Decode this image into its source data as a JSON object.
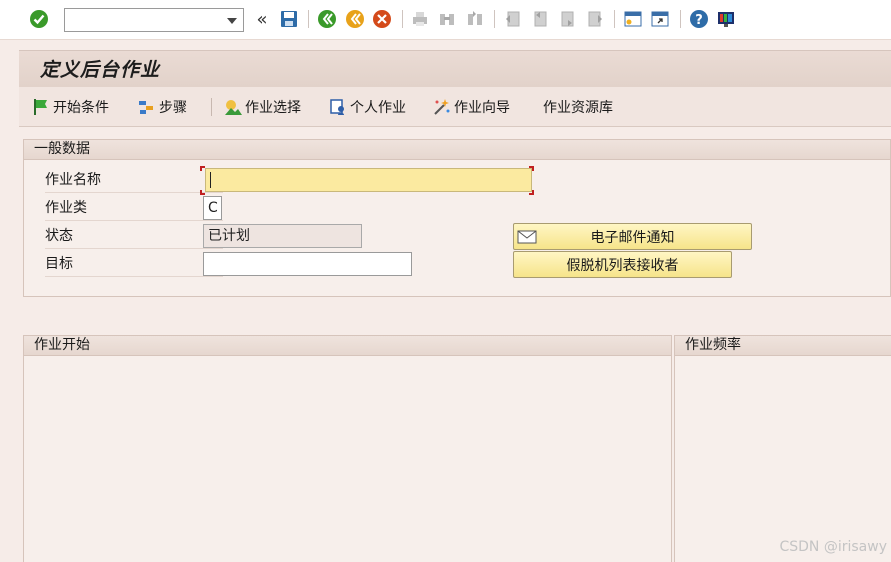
{
  "toolbar": {
    "command_field_value": "",
    "icons": [
      "enter-icon",
      "back-icon",
      "save-icon",
      "back-nav-icon",
      "exit-icon",
      "cancel-icon",
      "print-icon",
      "find-icon",
      "find-next-icon",
      "first-page-icon",
      "prev-page-icon",
      "next-page-icon",
      "last-page-icon",
      "new-session-icon",
      "shortcut-icon",
      "help-icon",
      "customize-layout-icon"
    ],
    "chevron": "«"
  },
  "title": "定义后台作业",
  "app_toolbar": {
    "start_condition": "开始条件",
    "steps": "步骤",
    "job_selection": "作业选择",
    "own_jobs": "个人作业",
    "job_wizard": "作业向导",
    "job_repository": "作业资源库"
  },
  "general_data": {
    "header": "一般数据",
    "job_name_label": "作业名称",
    "job_name_value": "",
    "job_class_label": "作业类",
    "job_class_value": "C",
    "status_label": "状态",
    "status_value": "已计划",
    "target_label": "目标",
    "target_value": "",
    "email_button": "电子邮件通知",
    "spool_button": "假脱机列表接收者"
  },
  "job_start": {
    "header": "作业开始"
  },
  "job_frequency": {
    "header": "作业频率"
  },
  "watermark": "CSDN @irisawy",
  "colors": {
    "title_bg": "#e2d2ca",
    "input_required": "#fbeaa0",
    "button_yellow": "#f6e48a",
    "window_bg": "#f6ece8"
  }
}
